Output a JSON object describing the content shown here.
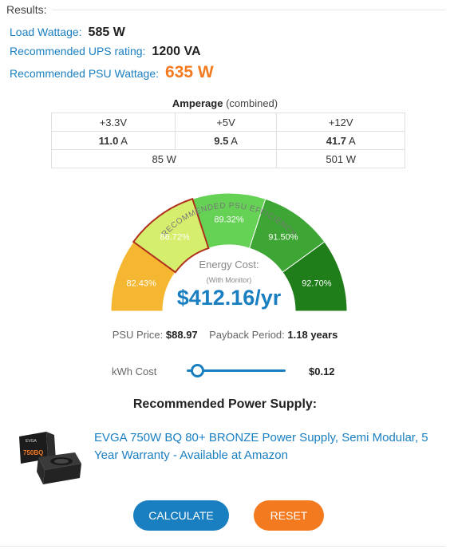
{
  "results": {
    "legend": "Results:",
    "load_label": "Load Wattage:",
    "load_value": "585 W",
    "ups_label": "Recommended UPS rating:",
    "ups_value": "1200 VA",
    "psu_label": "Recommended PSU Wattage:",
    "psu_value": "635 W"
  },
  "amperage": {
    "title": "Amperage",
    "subtitle": "(combined)",
    "headers": [
      "+3.3V",
      "+5V",
      "+12V"
    ],
    "values": [
      "11.0",
      "9.5",
      "41.7"
    ],
    "unit": "A",
    "watts_left": "85 W",
    "watts_right": "501 W"
  },
  "gauge": {
    "arc_label": "RECOMMENDED PSU EFFICIENCY",
    "segments": [
      {
        "label": "82.43%",
        "color": "#f5b731"
      },
      {
        "label": "86.72%",
        "color": "#d6ee6d",
        "selected": true
      },
      {
        "label": "89.32%",
        "color": "#65d155"
      },
      {
        "label": "91.50%",
        "color": "#3da634"
      },
      {
        "label": "92.70%",
        "color": "#1f7d1a"
      }
    ],
    "selected_outline": "#b0301e",
    "energy_label": "Energy Cost:",
    "energy_sub": "(With Monitor)",
    "energy_value": "$412.16/yr"
  },
  "payback": {
    "price_label": "PSU Price:",
    "price_value": "$88.97",
    "period_label": "Payback Period:",
    "period_value": "1.18 years"
  },
  "kwh": {
    "label": "kWh Cost",
    "value": "$0.12",
    "slider_fraction": 0.05
  },
  "recommendation": {
    "title": "Recommended Power Supply:",
    "product_text": "EVGA 750W BQ 80+ BRONZE Power Supply, Semi Modular, 5 Year Warranty - Available at Amazon",
    "image_brand": "EVGA",
    "image_model": "750BQ"
  },
  "buttons": {
    "calculate": "CALCULATE",
    "reset": "RESET"
  },
  "colors": {
    "link_blue": "#1a7fc1",
    "accent_orange": "#f47a20"
  }
}
